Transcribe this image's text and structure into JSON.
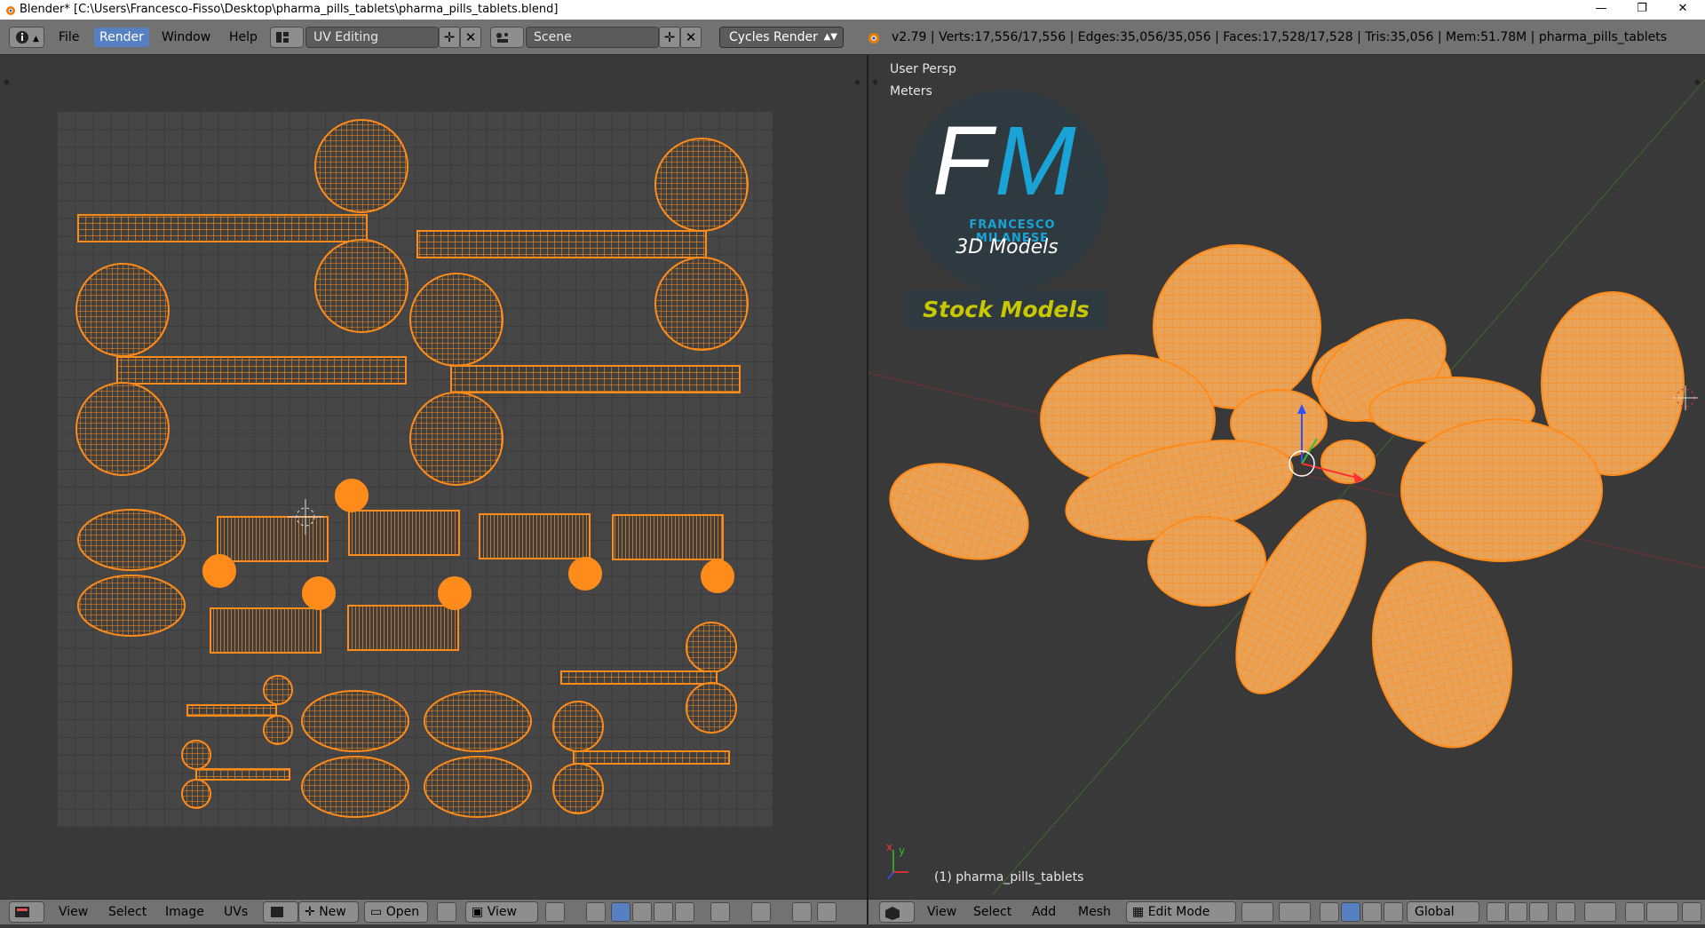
{
  "window": {
    "title": "Blender* [C:\\Users\\Francesco-Fisso\\Desktop\\pharma_pills_tablets\\pharma_pills_tablets.blend]",
    "minimize": "—",
    "maximize": "❐",
    "close": "✕"
  },
  "info_header": {
    "menus": [
      "File",
      "Render",
      "Window",
      "Help"
    ],
    "active_menu": "Render",
    "screen_layout": "UV Editing",
    "scene": "Scene",
    "render_engine": "Cycles Render",
    "stats": "v2.79 | Verts:17,556/17,556 | Edges:35,056/35,056 | Faces:17,528/17,528 | Tris:35,056 | Mem:51.78M | pharma_pills_tablets"
  },
  "viewport": {
    "view_name": "User Persp",
    "units": "Meters",
    "object_label": "(1) pharma_pills_tablets",
    "axis_x": "x",
    "axis_y": "y"
  },
  "watermark": {
    "letters_f": "F",
    "letters_m": "M",
    "brand": "FRANCESCO MILANESE",
    "tagline": "3D Models",
    "stock": "Stock Models",
    "colors": {
      "circle": "#2f3a40",
      "f": "#ffffff",
      "m": "#1aa3d6",
      "stock": "#c8c800"
    }
  },
  "uv_footer": {
    "menus": [
      "View",
      "Select",
      "Image",
      "UVs"
    ],
    "new_label": "New",
    "open_label": "Open",
    "view_label": "View"
  },
  "viewport_footer": {
    "menus": [
      "View",
      "Select",
      "Add",
      "Mesh"
    ],
    "mode": "Edit Mode",
    "orientation": "Global"
  },
  "colors": {
    "accent": "#5680c2",
    "mesh_orange": "#ff8c1a",
    "header_gray": "#727272",
    "background": "#393939"
  }
}
